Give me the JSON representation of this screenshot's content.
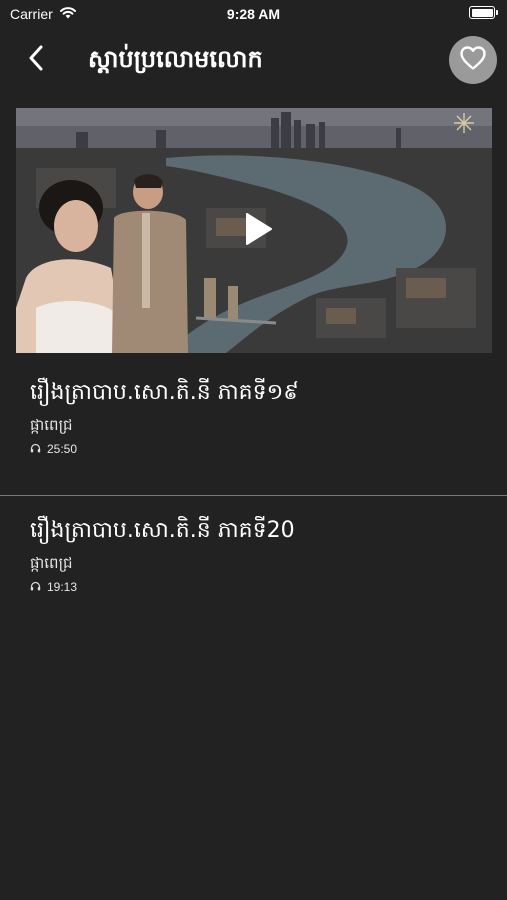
{
  "status_bar": {
    "carrier": "Carrier",
    "time": "9:28 AM",
    "icons": [
      "wifi-icon",
      "battery-icon"
    ]
  },
  "header": {
    "title": "ស្តាប់ប្រលោមលោក",
    "back_icon": "chevron-left-icon",
    "favorite_icon": "heart-outline-icon"
  },
  "video": {
    "play_icon": "play-icon"
  },
  "episodes": [
    {
      "title": "រឿងត្រាបាប.សោ.តិ.នី ភាគទី១៩",
      "author": "ផ្កាពេជ្រ",
      "duration": "25:50",
      "duration_icon": "headphones-icon"
    },
    {
      "title": "រឿងត្រាបាប.សោ.តិ.នី ភាគទី20",
      "author": "ផ្កាពេជ្រ",
      "duration": "19:13",
      "duration_icon": "headphones-icon"
    }
  ],
  "colors": {
    "background": "#222222",
    "divider": "#7a7a7a",
    "favorite_bg": "#9a9a9a",
    "text": "#ffffff"
  }
}
